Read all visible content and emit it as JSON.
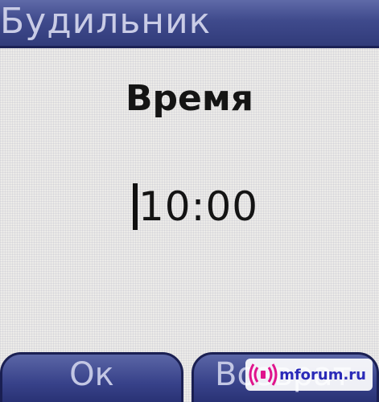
{
  "window": {
    "title": "Будильник"
  },
  "alarm": {
    "label": "Время",
    "time": "10:00"
  },
  "softkeys": {
    "left_label": "Ок",
    "right_label": "Возврат"
  },
  "watermark": {
    "text": "mforum.ru",
    "icon": "signal-waves-icon"
  },
  "colors": {
    "title_bar": "#3f4a8c",
    "title_text": "#c9cce6",
    "background": "#ecebe8",
    "softkey": "#38428a",
    "text": "#141414",
    "watermark_accent": "#e0148c"
  }
}
